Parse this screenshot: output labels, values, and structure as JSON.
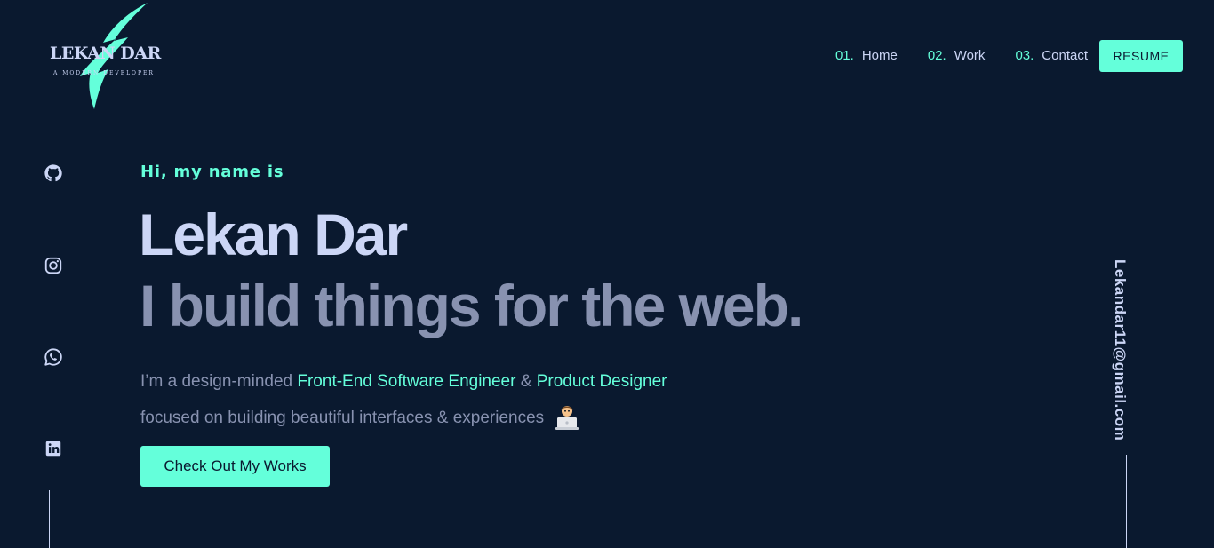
{
  "logo": {
    "title": "LEKAN DAR",
    "subtitle": "A MODERN DEVELOPER",
    "accent_color": "#64ffda"
  },
  "nav": {
    "items": [
      {
        "num": "01.",
        "label": "Home"
      },
      {
        "num": "02.",
        "label": "Work"
      },
      {
        "num": "03.",
        "label": "Contact"
      }
    ],
    "resume_label": "RESUME"
  },
  "social": {
    "icons": [
      "github-icon",
      "instagram-icon",
      "whatsapp-icon",
      "linkedin-icon"
    ]
  },
  "hero": {
    "greeting": "Hi, my name is",
    "name": "Lekan Dar",
    "tagline": "I build things for the web.",
    "desc_prefix": "I’m a design-minded ",
    "role1": "Front-End Software Engineer",
    "amp": " & ",
    "role2": "Product Designer",
    "desc_line2": "focused on building beautiful interfaces & experiences",
    "emoji_icon": "technologist-emoji-icon",
    "cta_label": "Check Out My Works"
  },
  "email": "Lekandar11@gmail.com",
  "colors": {
    "background": "#0a192f",
    "accent": "#64ffda",
    "light_text": "#ccd6f6",
    "muted_text": "#8892b0"
  }
}
